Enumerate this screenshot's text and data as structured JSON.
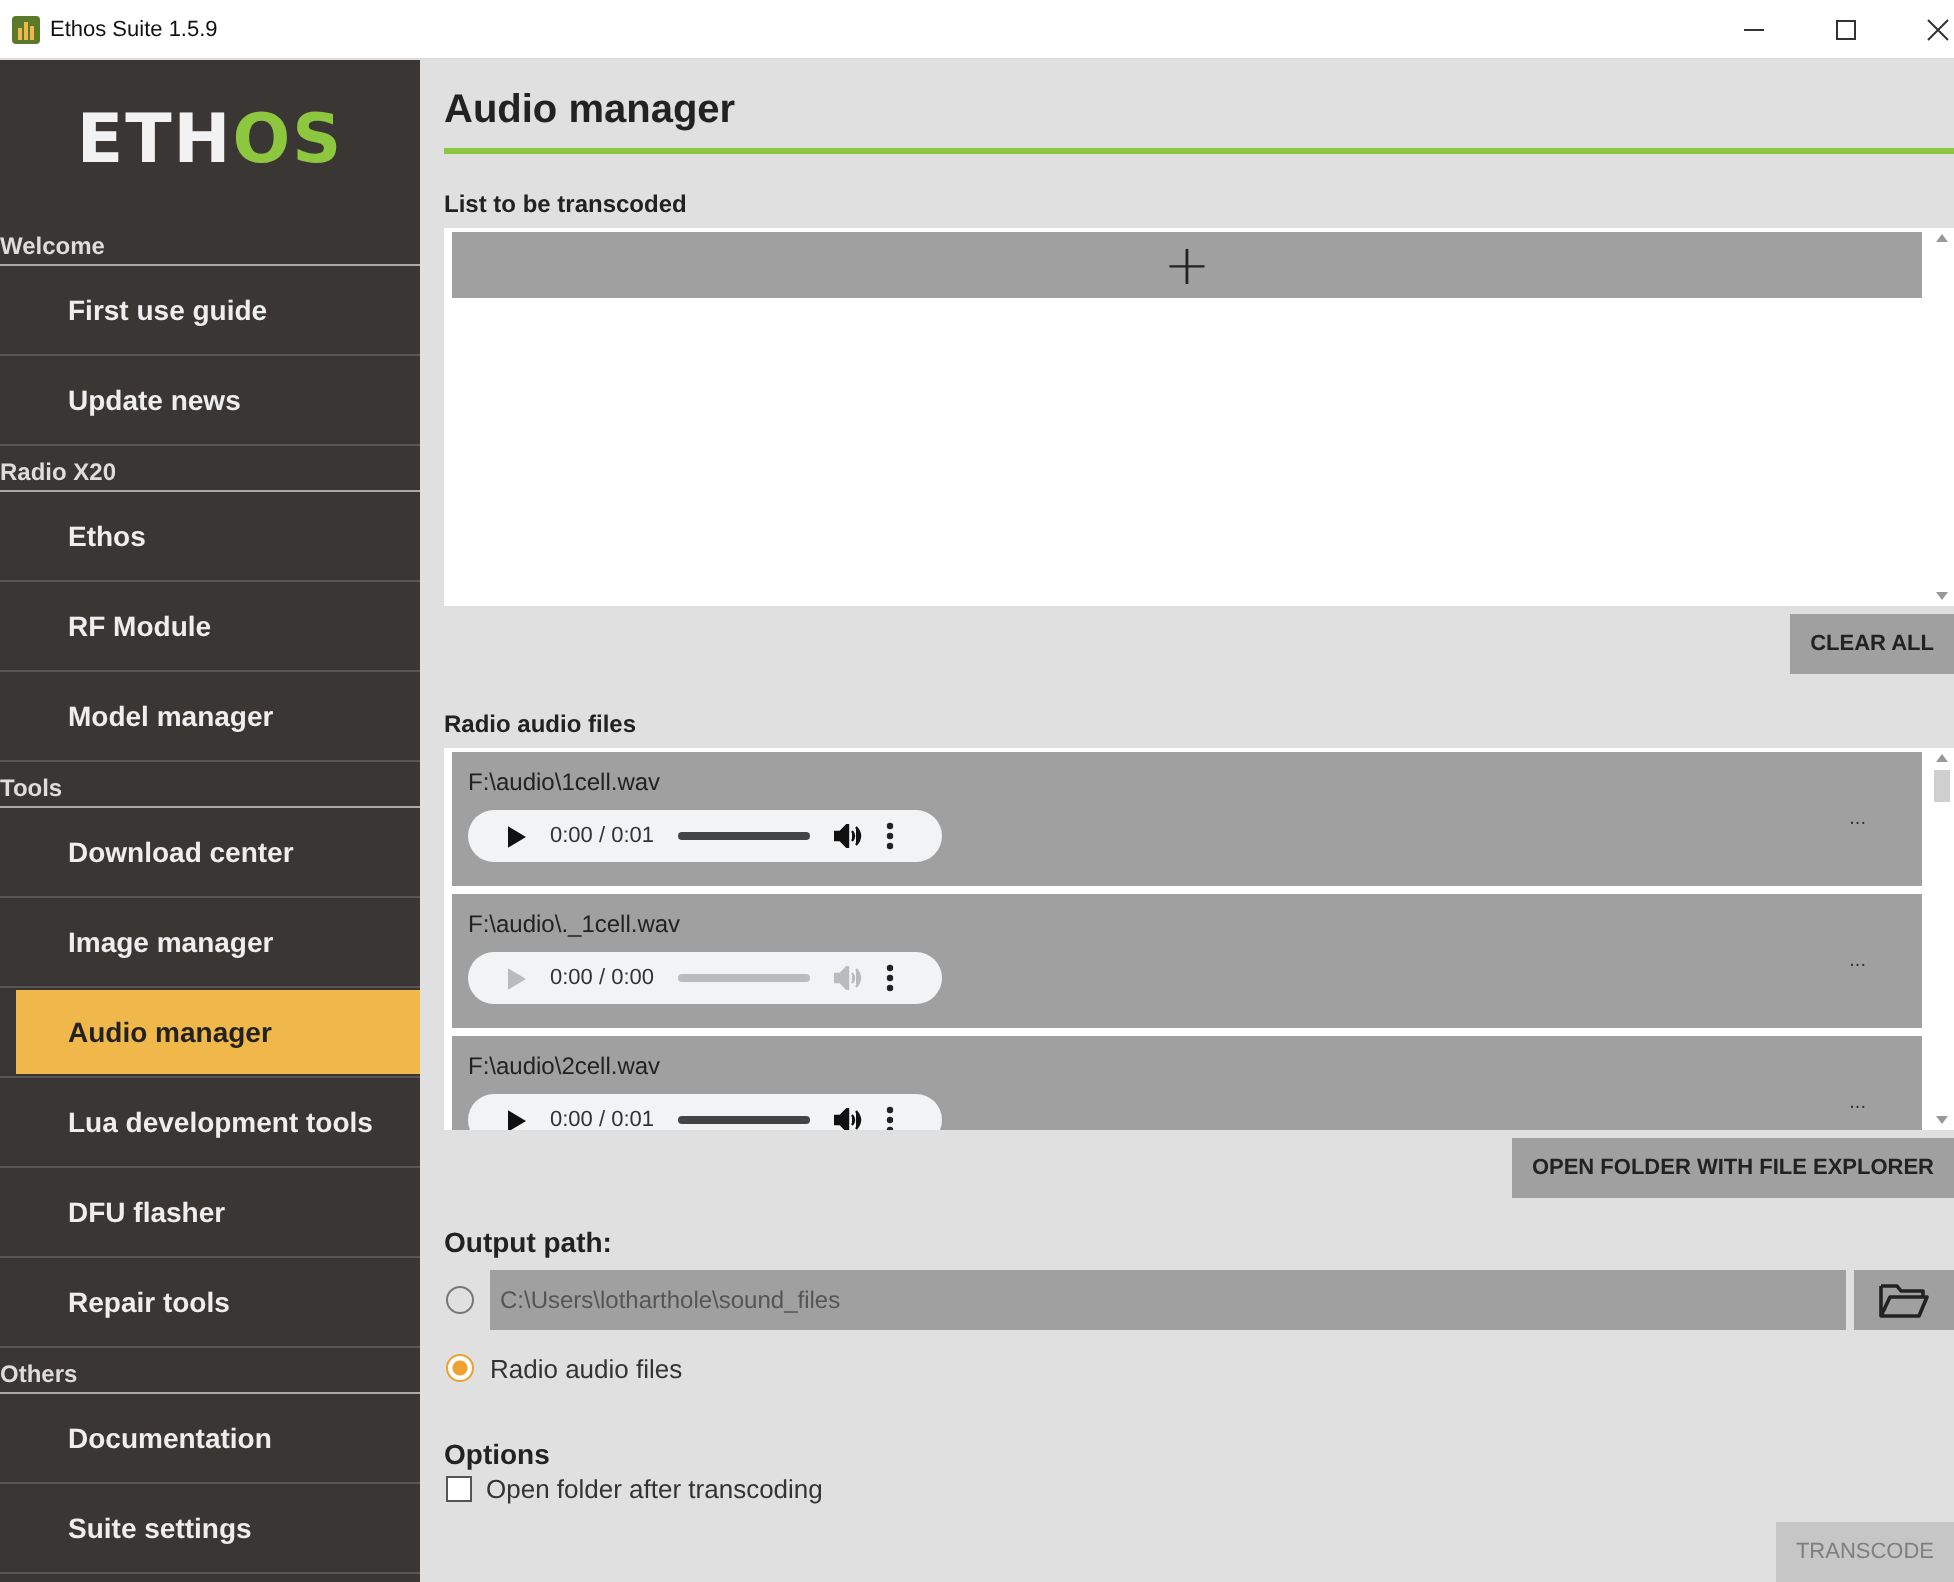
{
  "window": {
    "title": "Ethos Suite 1.5.9"
  },
  "logo": {
    "text": "ETH",
    "accent": "OS"
  },
  "sidebar": {
    "items": [
      {
        "kind": "header",
        "label": "Welcome"
      },
      {
        "kind": "item",
        "label": "First use guide",
        "selected": false
      },
      {
        "kind": "item",
        "label": "Update news",
        "selected": false
      },
      {
        "kind": "header",
        "label": "Radio X20"
      },
      {
        "kind": "item",
        "label": "Ethos",
        "selected": false
      },
      {
        "kind": "item",
        "label": "RF Module",
        "selected": false
      },
      {
        "kind": "item",
        "label": "Model manager",
        "selected": false
      },
      {
        "kind": "header",
        "label": "Tools"
      },
      {
        "kind": "item",
        "label": "Download center",
        "selected": false
      },
      {
        "kind": "item",
        "label": "Image manager",
        "selected": false
      },
      {
        "kind": "item",
        "label": "Audio manager",
        "selected": true
      },
      {
        "kind": "item",
        "label": "Lua development tools",
        "selected": false
      },
      {
        "kind": "item",
        "label": "DFU flasher",
        "selected": false
      },
      {
        "kind": "item",
        "label": "Repair tools",
        "selected": false
      },
      {
        "kind": "header",
        "label": "Others"
      },
      {
        "kind": "item",
        "label": "Documentation",
        "selected": false
      },
      {
        "kind": "item",
        "label": "Suite settings",
        "selected": false
      }
    ]
  },
  "page_title": "Audio manager",
  "transcode_list": {
    "label": "List to be transcoded",
    "add_button": "+",
    "clear_button": "CLEAR ALL"
  },
  "radio_files": {
    "label": "Radio audio files",
    "files": [
      {
        "path": "F:\\audio\\1cell.wav",
        "time": "0:00 / 0:01",
        "disabled": false,
        "more": "..."
      },
      {
        "path": "F:\\audio\\._1cell.wav",
        "time": "0:00 / 0:00",
        "disabled": true,
        "more": "..."
      },
      {
        "path": "F:\\audio\\2cell.wav",
        "time": "0:00 / 0:01",
        "disabled": false,
        "more": "..."
      }
    ],
    "open_button": "OPEN FOLDER WITH FILE EXPLORER"
  },
  "output": {
    "label": "Output path:",
    "options": [
      {
        "kind": "path",
        "value": "C:\\Users\\lotharthole\\sound_files",
        "selected": false
      },
      {
        "kind": "radio",
        "label": "Radio audio files",
        "selected": true
      }
    ]
  },
  "options": {
    "label": "Options",
    "checkboxes": [
      {
        "label": "Open folder after transcoding",
        "checked": false
      }
    ]
  },
  "transcode_button": {
    "label": "TRANSCODE",
    "disabled": true
  }
}
